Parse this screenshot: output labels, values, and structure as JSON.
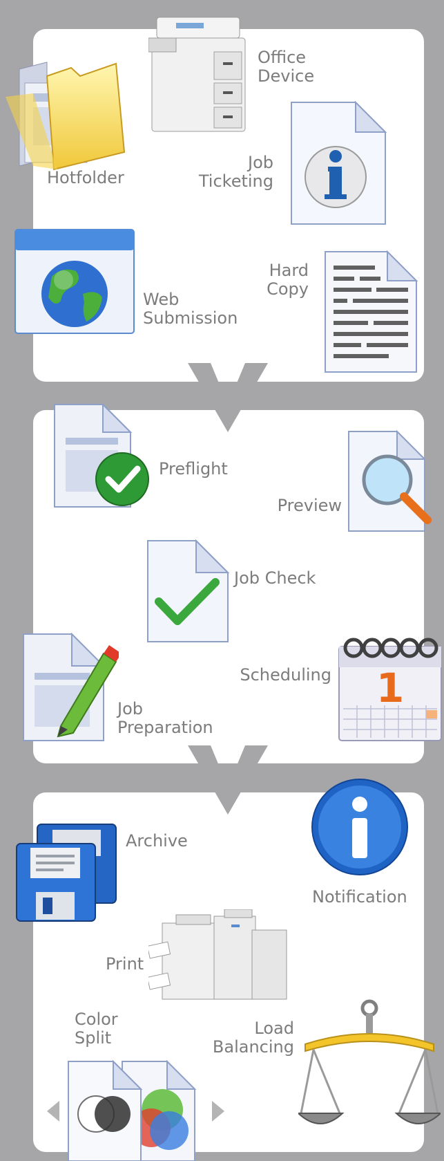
{
  "colors": {
    "background": "#a6a6a8",
    "panel": "#ffffff",
    "label": "#7c7c7c",
    "arrow": "#a6a6a8"
  },
  "sections": [
    {
      "items": [
        {
          "key": "hotfolder",
          "icon": "folder-icon",
          "lines": [
            "Hotfolder"
          ]
        },
        {
          "key": "office_device",
          "icon": "copier-icon",
          "lines": [
            "Office",
            "Device"
          ]
        },
        {
          "key": "job_ticketing",
          "icon": "info-document-icon",
          "lines": [
            "Job",
            "Ticketing"
          ]
        },
        {
          "key": "web_submission",
          "icon": "globe-window-icon",
          "lines": [
            "Web",
            "Submission"
          ]
        },
        {
          "key": "hard_copy",
          "icon": "text-document-icon",
          "lines": [
            "Hard",
            "Copy"
          ]
        }
      ]
    },
    {
      "items": [
        {
          "key": "preflight",
          "icon": "document-check-badge-icon",
          "lines": [
            "Preflight"
          ]
        },
        {
          "key": "preview",
          "icon": "document-magnifier-icon",
          "lines": [
            "Preview"
          ]
        },
        {
          "key": "job_check",
          "icon": "document-checkmark-icon",
          "lines": [
            "Job Check"
          ]
        },
        {
          "key": "scheduling",
          "icon": "calendar-icon",
          "lines": [
            "Scheduling"
          ]
        },
        {
          "key": "job_preparation",
          "icon": "document-pencil-icon",
          "lines": [
            "Job",
            "Preparation"
          ]
        }
      ]
    },
    {
      "items": [
        {
          "key": "archive",
          "icon": "floppy-disk-icon",
          "lines": [
            "Archive"
          ]
        },
        {
          "key": "notification",
          "icon": "info-circle-icon",
          "lines": [
            "Notification"
          ]
        },
        {
          "key": "print",
          "icon": "production-printer-icon",
          "lines": [
            "Print"
          ]
        },
        {
          "key": "color_split",
          "icon": "color-documents-icon",
          "lines": [
            "Color",
            "Split"
          ]
        },
        {
          "key": "load_balancing",
          "icon": "scales-icon",
          "lines": [
            "Load",
            "Balancing"
          ]
        }
      ]
    }
  ]
}
